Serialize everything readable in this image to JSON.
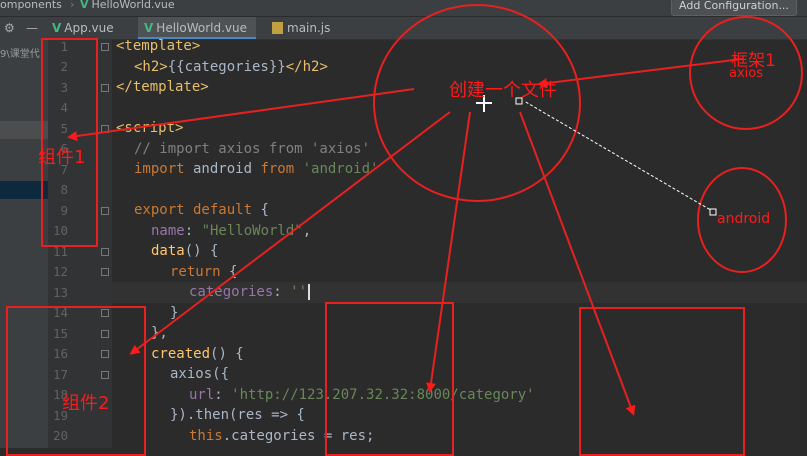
{
  "breadcrumb": {
    "components": "omponents",
    "file": "HelloWorld.vue"
  },
  "toolbar": {
    "add_configuration": "Add Configuration..."
  },
  "tabs": [
    {
      "label": "App.vue",
      "icon": "vue-icon"
    },
    {
      "label": "HelloWorld.vue",
      "icon": "vue-icon",
      "active": true
    },
    {
      "label": "main.js",
      "icon": "js-file-icon"
    }
  ],
  "sidebar": {
    "text": "9\\课堂代"
  },
  "line_numbers": [
    "1",
    "2",
    "3",
    "4",
    "5",
    "6",
    "7",
    "8",
    "9",
    "10",
    "11",
    "12",
    "13",
    "14",
    "15",
    "16",
    "17",
    "18",
    "19",
    "20"
  ],
  "code": {
    "l1_tag": "<template>",
    "l2_open": "<h2>",
    "l2_expr": "{{categories}}",
    "l2_close": "</h2>",
    "l3_tag": "</template>",
    "l5_tag": "<script>",
    "l6_comment": "// import axios from 'axios'",
    "l7_import": "import",
    "l7_name": " android ",
    "l7_from": "from",
    "l7_str": "'android'",
    "l9_kw": "export default",
    "l9_brace": " {",
    "l10_prop": "name",
    "l10_colon": ": ",
    "l10_str": "\"HelloWorld\"",
    "l10_comma": ",",
    "l11_fn": "data",
    "l11_rest": "() {",
    "l12_kw": "return",
    "l12_brace": " {",
    "l13_prop": "categories",
    "l13_colon": ": ",
    "l13_str": "''",
    "l14": "}",
    "l15": "},",
    "l16_fn": "created",
    "l16_rest": "() {",
    "l17": "axios({",
    "l18_prop": "url",
    "l18_colon": ": ",
    "l18_str": "'http://123.207.32.32:8000/category'",
    "l19": "}).then(res => {",
    "l20_kw": "this",
    "l20_rest": ".categories = res;"
  },
  "annotations": {
    "create_file": "创建一个文件",
    "framework1": "框架1",
    "axios": "axios",
    "android": "android",
    "component1": "组件1",
    "component2": "组件2"
  },
  "colors": {
    "annotation": "#ff1a1a",
    "editor_bg": "#2b2b2b",
    "keyword": "#cc7832",
    "string": "#6a8759"
  }
}
